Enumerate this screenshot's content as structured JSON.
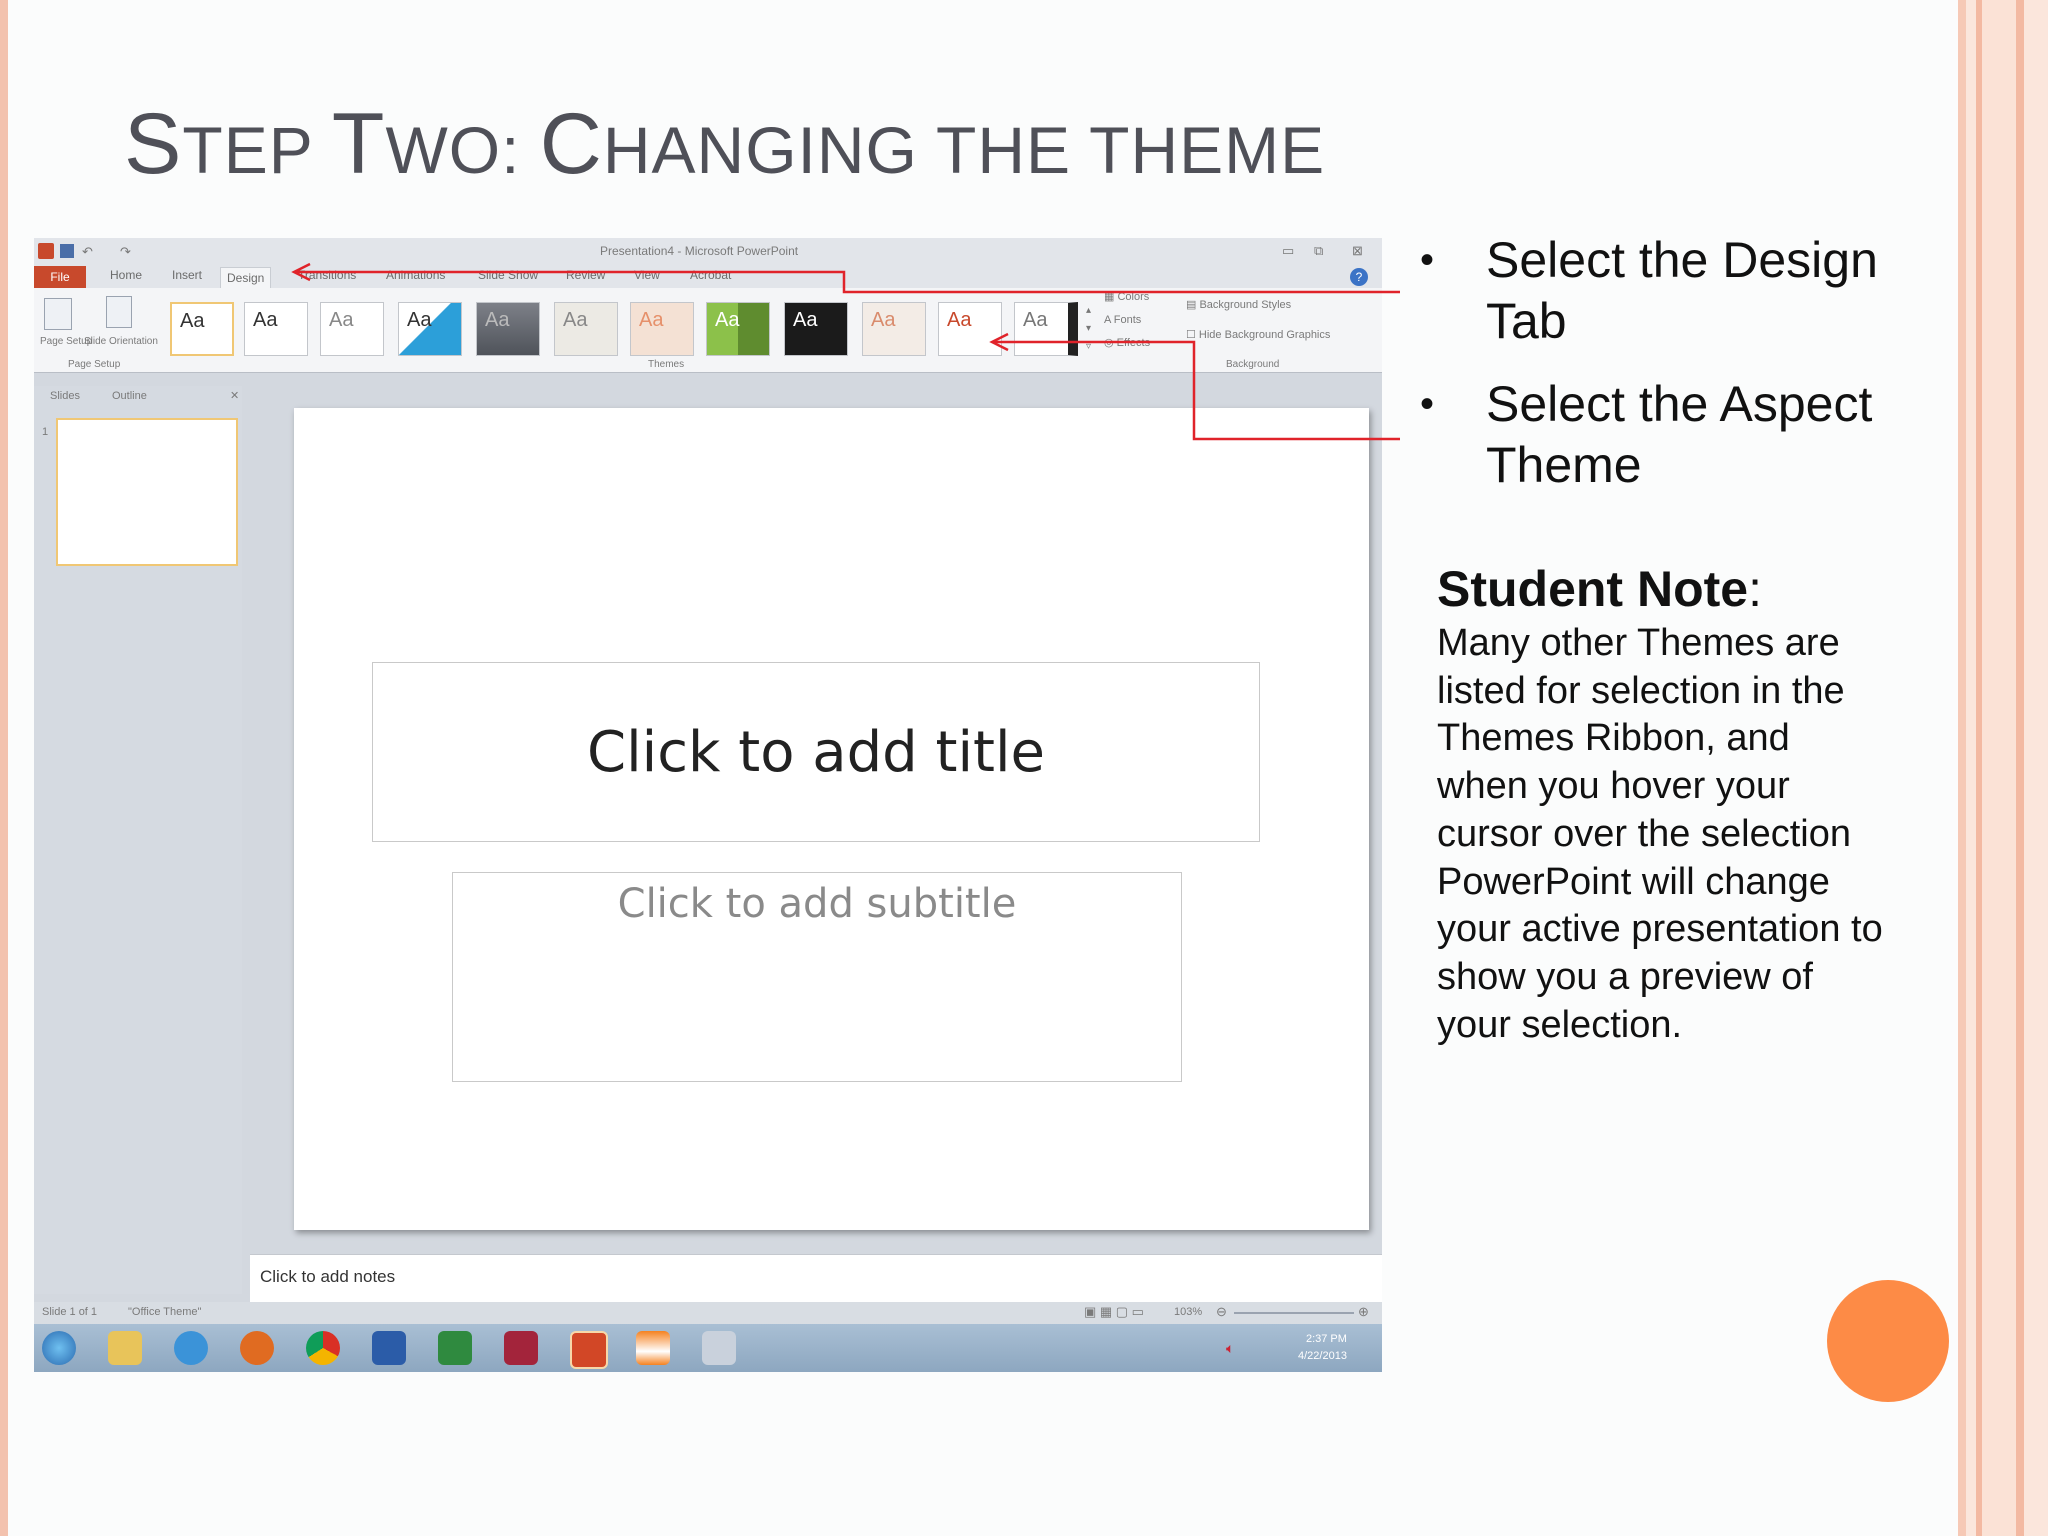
{
  "slide": {
    "title_parts": [
      "S",
      "TEP ",
      "T",
      "WO: ",
      "C",
      "HANGING THE THEME"
    ],
    "bullets": [
      "Select the Design Tab",
      "Select the Aspect Theme"
    ],
    "note": {
      "heading": "Student Note",
      "heading_suffix": ":",
      "lines": [
        "Many other Themes are",
        "listed for selection in the",
        "Themes Ribbon, and",
        "when you hover your",
        "cursor over the selection",
        "PowerPoint will change",
        "your active presentation to",
        "show you a preview of",
        "your selection."
      ]
    }
  },
  "powerpoint": {
    "window_title": "Presentation4 - Microsoft PowerPoint",
    "tabs": [
      "File",
      "Home",
      "Insert",
      "Design",
      "Transitions",
      "Animations",
      "Slide Show",
      "Review",
      "View",
      "Acrobat"
    ],
    "ribbon": {
      "page_setup": "Page Setup",
      "slide_orientation": "Slide Orientation",
      "group_page_setup": "Page Setup",
      "group_themes": "Themes",
      "group_background": "Background",
      "colors": "Colors",
      "fonts": "Fonts",
      "effects": "Effects",
      "background_styles": "Background Styles",
      "hide_background_graphics": "Hide Background Graphics",
      "theme_label": "Aa"
    },
    "panel_tabs": [
      "Slides",
      "Outline"
    ],
    "slide_number": "1",
    "placeholder_title": "Click to add title",
    "placeholder_subtitle": "Click to add subtitle",
    "notes_placeholder": "Click to add notes",
    "status": {
      "slide_count": "Slide 1 of 1",
      "theme": "\"Office Theme\"",
      "zoom": "103%"
    },
    "clock": {
      "time": "2:37 PM",
      "date": "4/22/2013"
    }
  },
  "colors": {
    "accent_orange": "#fd8b46",
    "border_salmon": "#f3b9a2",
    "title_gray": "#4f5058",
    "annotation_red": "#e0232a"
  }
}
